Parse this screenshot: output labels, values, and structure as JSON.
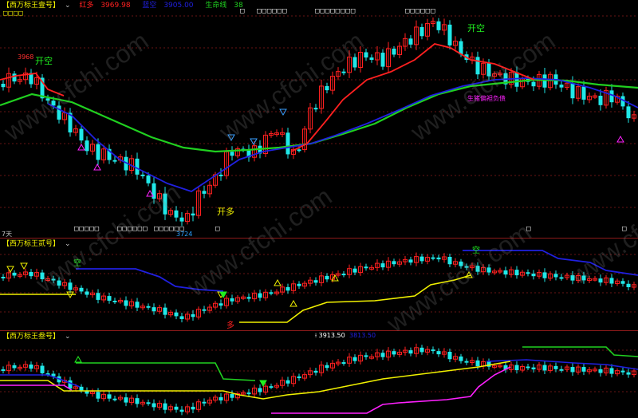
{
  "colors": {
    "up": "#ff2020",
    "down": "#20e8e8",
    "ma_green": "#20d020",
    "ma_blue": "#2020e0",
    "ma_red": "#ff2020",
    "yellow": "#f0f000",
    "magenta": "#ff20ff",
    "grid": "#8b1a1a"
  },
  "watermark": "www.cfchi.com",
  "panel1": {
    "title": "【西万标王壹号】",
    "chevron": "⌄",
    "legend": [
      {
        "label": "红多",
        "value": "3969.98",
        "color": "#ff2020"
      },
      {
        "label": "蓝空",
        "value": "3905.00",
        "color": "#2020e0"
      },
      {
        "label": "生命线",
        "value": "38",
        "color": "#20d020"
      }
    ],
    "top_boxes": [
      "□",
      "□□□□□□",
      "□□□□□□□□",
      "□□□□□□"
    ],
    "left_boxes": "□□□□",
    "bottom_boxes": [
      "□□□□□",
      "□□□□□□",
      "□□□□□□",
      "□",
      "□",
      "□"
    ],
    "high_value": "3968",
    "low_value": "3724",
    "signals": [
      {
        "text": "开空",
        "color": "#20f020"
      },
      {
        "text": "开空",
        "color": "#20f020"
      },
      {
        "text": "开多",
        "color": "#f0f000"
      }
    ],
    "annotation": "生猪偏袒负债",
    "period_label": "7天"
  },
  "panel2": {
    "title": "【西万标王贰号】",
    "chevron": "⌄",
    "signals": [
      {
        "text": "空",
        "color": "#20f020"
      },
      {
        "text": "多",
        "color": "#ff2020"
      }
    ]
  },
  "panel3": {
    "title": "【西万标王叁号】",
    "chevron": "⌄",
    "legend": [
      {
        "label": "",
        "value": "3913.50",
        "color": "#ffffff"
      },
      {
        "label": "",
        "value": "3813.50",
        "color": "#2020e0"
      }
    ]
  }
}
